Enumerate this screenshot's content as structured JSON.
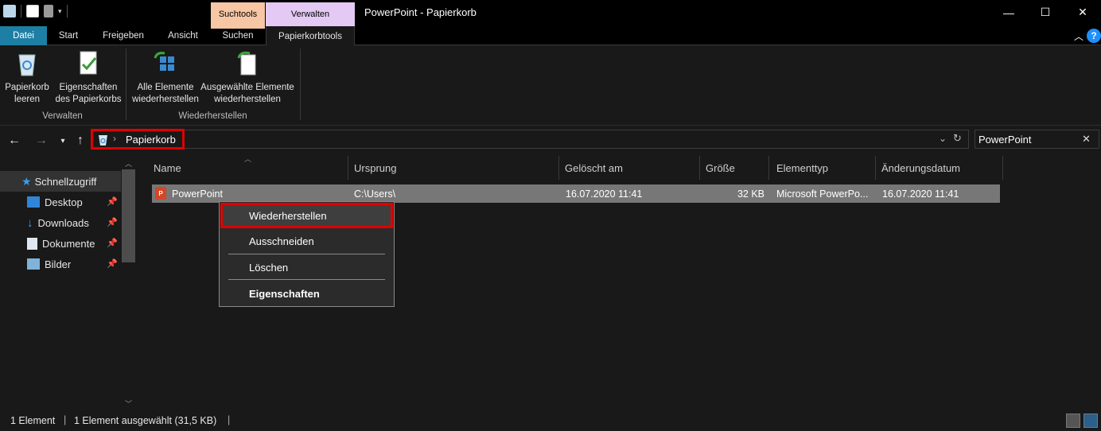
{
  "window": {
    "title": "PowerPoint - Papierkorb",
    "minimize": "—",
    "maximize": "☐",
    "close": "✕"
  },
  "context_tabs": {
    "suchtools": "Suchtools",
    "verwalten": "Verwalten"
  },
  "tabs": [
    {
      "label": "Datei"
    },
    {
      "label": "Start"
    },
    {
      "label": "Freigeben"
    },
    {
      "label": "Ansicht"
    },
    {
      "label": "Suchen"
    },
    {
      "label": "Papierkorbtools"
    }
  ],
  "ribbon": {
    "buttons": [
      {
        "line1": "Papierkorb",
        "line2": "leeren"
      },
      {
        "line1": "Eigenschaften",
        "line2": "des Papierkorbs"
      },
      {
        "line1": "Alle Elemente",
        "line2": "wiederherstellen"
      },
      {
        "line1": "Ausgewählte Elemente",
        "line2": "wiederherstellen"
      }
    ],
    "groups": [
      "Verwalten",
      "Wiederherstellen"
    ]
  },
  "address": {
    "path": "Papierkorb",
    "search_value": "PowerPoint"
  },
  "nav": {
    "items": [
      {
        "label": "Schnellzugriff"
      },
      {
        "label": "Desktop"
      },
      {
        "label": "Downloads"
      },
      {
        "label": "Dokumente"
      },
      {
        "label": "Bilder"
      }
    ]
  },
  "columns": [
    "Name",
    "Ursprung",
    "Gelöscht am",
    "Größe",
    "Elementtyp",
    "Änderungsdatum"
  ],
  "files": [
    {
      "name": "PowerPoint",
      "origin": "C:\\Users\\",
      "deleted": "16.07.2020 11:41",
      "size": "32 KB",
      "type": "Microsoft PowerPo...",
      "modified": "16.07.2020 11:41"
    }
  ],
  "context_menu": {
    "items": [
      "Wiederherstellen",
      "Ausschneiden",
      "Löschen",
      "Eigenschaften"
    ]
  },
  "status": {
    "count": "1 Element",
    "selected": "1 Element ausgewählt (31,5 KB)"
  },
  "colors": {
    "accent_datei": "#1e7fa5",
    "highlight": "#e00000",
    "suchtools": "#f6c6a5",
    "verwalten": "#e3c9f3"
  }
}
